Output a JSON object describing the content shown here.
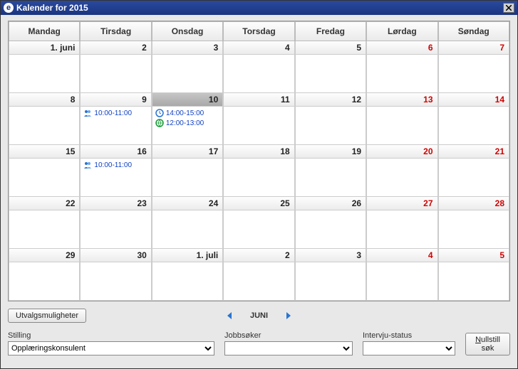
{
  "window": {
    "title": "Kalender for 2015"
  },
  "calendar": {
    "headers": [
      "Mandag",
      "Tirsdag",
      "Onsdag",
      "Torsdag",
      "Fredag",
      "Lørdag",
      "Søndag"
    ],
    "weeks": [
      {
        "days": [
          {
            "label": "1. juni",
            "weekend": false
          },
          {
            "label": "2",
            "weekend": false
          },
          {
            "label": "3",
            "weekend": false
          },
          {
            "label": "4",
            "weekend": false
          },
          {
            "label": "5",
            "weekend": false
          },
          {
            "label": "6",
            "weekend": true
          },
          {
            "label": "7",
            "weekend": true
          }
        ],
        "events": [
          [],
          [],
          [],
          [],
          [],
          [],
          []
        ]
      },
      {
        "days": [
          {
            "label": "8",
            "weekend": false
          },
          {
            "label": "9",
            "weekend": false
          },
          {
            "label": "10",
            "weekend": false,
            "selected": true
          },
          {
            "label": "11",
            "weekend": false
          },
          {
            "label": "12",
            "weekend": false
          },
          {
            "label": "13",
            "weekend": true
          },
          {
            "label": "14",
            "weekend": true
          }
        ],
        "events": [
          [],
          [
            {
              "icon": "people",
              "label": "10:00-11:00"
            }
          ],
          [
            {
              "icon": "clock",
              "label": "14:00-15:00"
            },
            {
              "icon": "globe",
              "label": "12:00-13:00"
            }
          ],
          [],
          [],
          [],
          []
        ]
      },
      {
        "days": [
          {
            "label": "15",
            "weekend": false
          },
          {
            "label": "16",
            "weekend": false
          },
          {
            "label": "17",
            "weekend": false
          },
          {
            "label": "18",
            "weekend": false
          },
          {
            "label": "19",
            "weekend": false
          },
          {
            "label": "20",
            "weekend": true
          },
          {
            "label": "21",
            "weekend": true
          }
        ],
        "events": [
          [],
          [
            {
              "icon": "people",
              "label": "10:00-11:00"
            }
          ],
          [],
          [],
          [],
          [],
          []
        ]
      },
      {
        "days": [
          {
            "label": "22",
            "weekend": false
          },
          {
            "label": "23",
            "weekend": false
          },
          {
            "label": "24",
            "weekend": false
          },
          {
            "label": "25",
            "weekend": false
          },
          {
            "label": "26",
            "weekend": false
          },
          {
            "label": "27",
            "weekend": true
          },
          {
            "label": "28",
            "weekend": true
          }
        ],
        "events": [
          [],
          [],
          [],
          [],
          [],
          [],
          []
        ]
      },
      {
        "days": [
          {
            "label": "29",
            "weekend": false
          },
          {
            "label": "30",
            "weekend": false
          },
          {
            "label": "1. juli",
            "weekend": false
          },
          {
            "label": "2",
            "weekend": false
          },
          {
            "label": "3",
            "weekend": false
          },
          {
            "label": "4",
            "weekend": true
          },
          {
            "label": "5",
            "weekend": true
          }
        ],
        "events": [
          [],
          [],
          [],
          [],
          [],
          [],
          []
        ]
      }
    ]
  },
  "nav": {
    "options_button": "Utvalgsmuligheter",
    "month_label": "JUNI"
  },
  "filters": {
    "stilling_label": "Stilling",
    "stilling_value": "Opplæringskonsulent",
    "jobbsoker_label": "Jobbsøker",
    "jobbsoker_value": "",
    "status_label": "Intervju-status",
    "status_value": "",
    "reset_prefix": "N",
    "reset_rest": "ullstill søk"
  },
  "icons": {
    "people_color": "#2a74d0",
    "clock_color": "#2a74d0",
    "globe_color": "#1a9a3a",
    "arrow_color": "#2a74d0"
  }
}
